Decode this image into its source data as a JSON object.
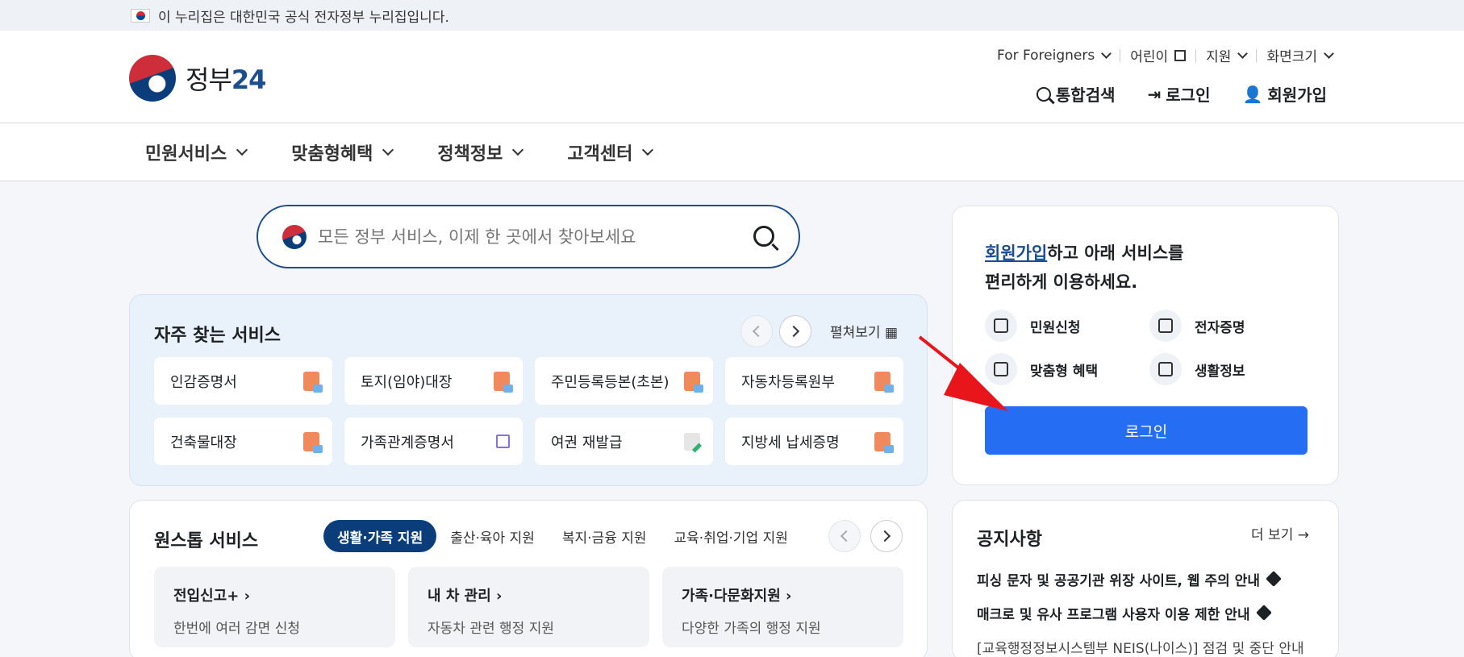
{
  "gov_bar": {
    "text": "이 누리집은 대한민국 공식 전자정부 누리집입니다."
  },
  "logo": {
    "text_main": "정부",
    "text_num": "24"
  },
  "util": {
    "foreigners": "For Foreigners",
    "kids": "어린이",
    "support": "지원",
    "screen_size": "화면크기"
  },
  "actions": {
    "search": "통합검색",
    "login": "로그인",
    "signup": "회원가입"
  },
  "nav": [
    "민원서비스",
    "맞춤형혜택",
    "정책정보",
    "고객센터"
  ],
  "search": {
    "placeholder": "모든 정부 서비스, 이제 한 곳에서 찾아보세요"
  },
  "frequent": {
    "title": "자주 찾는 서비스",
    "expand": "펼쳐보기",
    "items": [
      {
        "label": "인감증명서",
        "icon": "document-icon"
      },
      {
        "label": "토지(임야)대장",
        "icon": "document-icon"
      },
      {
        "label": "주민등록등본(초본)",
        "icon": "document-icon"
      },
      {
        "label": "자동차등록원부",
        "icon": "document-icon"
      },
      {
        "label": "건축물대장",
        "icon": "document-icon"
      },
      {
        "label": "가족관계증명서",
        "icon": "external-link-icon"
      },
      {
        "label": "여권 재발급",
        "icon": "edit-icon"
      },
      {
        "label": "지방세 납세증명",
        "icon": "document-icon"
      }
    ]
  },
  "onestop": {
    "title": "원스톱 서비스",
    "tabs": [
      "생활·가족 지원",
      "출산·육아 지원",
      "복지·금융 지원",
      "교육·취업·기업 지원"
    ],
    "cards": [
      {
        "title": "전입신고+",
        "desc": "한번에 여러 감면 신청"
      },
      {
        "title": "내 차 관리",
        "desc": "자동차 관련 행정 지원"
      },
      {
        "title": "가족·다문화지원",
        "desc": "다양한 가족의 행정 지원"
      }
    ]
  },
  "login_card": {
    "signup_link": "회원가입",
    "head_rest": "하고 아래 서비스를",
    "head_line2": "편리하게 이용하세요.",
    "services": [
      "민원신청",
      "전자증명",
      "맞춤형 혜택",
      "생활정보"
    ],
    "login_button": "로그인"
  },
  "notice": {
    "title": "공지사항",
    "more": "더 보기 →",
    "items": [
      "피싱 문자 및 공공기관 위장 사이트, 웹 주의 안내",
      "매크로 및 유사 프로그램 사용자 이용 제한 안내",
      "[교육행정정보시스템부 NEIS(나이스)] 점검 및 중단 안내"
    ]
  },
  "colors": {
    "primary": "#256ef4",
    "navy": "#0b3d7a",
    "annotation_arrow": "#e8151b"
  }
}
